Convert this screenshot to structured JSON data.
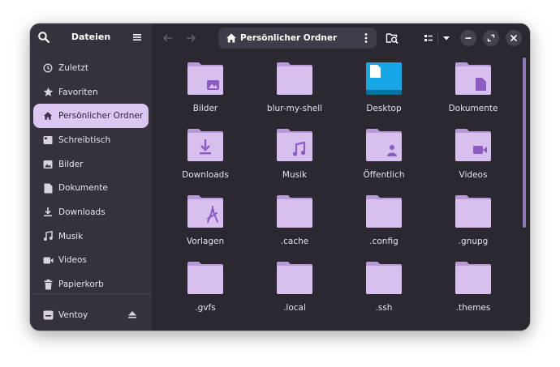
{
  "app": {
    "title": "Dateien"
  },
  "sidebar": {
    "items": [
      {
        "label": "Zuletzt",
        "icon": "clock-icon"
      },
      {
        "label": "Favoriten",
        "icon": "star-icon"
      },
      {
        "label": "Persönlicher Ordner",
        "icon": "home-icon",
        "active": true
      },
      {
        "label": "Schreibtisch",
        "icon": "desktop-icon"
      },
      {
        "label": "Bilder",
        "icon": "image-icon"
      },
      {
        "label": "Dokumente",
        "icon": "document-icon"
      },
      {
        "label": "Downloads",
        "icon": "download-icon"
      },
      {
        "label": "Musik",
        "icon": "music-icon"
      },
      {
        "label": "Videos",
        "icon": "video-icon"
      },
      {
        "label": "Papierkorb",
        "icon": "trash-icon"
      }
    ],
    "device": {
      "label": "Ventoy",
      "icon": "drive-icon"
    }
  },
  "pathbar": {
    "label": "Persönlicher Ordner"
  },
  "files": [
    {
      "name": "Bilder",
      "emblem": "image"
    },
    {
      "name": "blur-my-shell",
      "emblem": "none"
    },
    {
      "name": "Desktop",
      "emblem": "desktop"
    },
    {
      "name": "Dokumente",
      "emblem": "document"
    },
    {
      "name": "Downloads",
      "emblem": "download"
    },
    {
      "name": "Musik",
      "emblem": "music"
    },
    {
      "name": "Öffentlich",
      "emblem": "person"
    },
    {
      "name": "Videos",
      "emblem": "video"
    },
    {
      "name": "Vorlagen",
      "emblem": "template"
    },
    {
      "name": ".cache",
      "emblem": "none"
    },
    {
      "name": ".config",
      "emblem": "none"
    },
    {
      "name": ".gnupg",
      "emblem": "none"
    },
    {
      "name": ".gvfs",
      "emblem": "none"
    },
    {
      "name": ".local",
      "emblem": "none"
    },
    {
      "name": ".ssh",
      "emblem": "none"
    },
    {
      "name": ".themes",
      "emblem": "none"
    }
  ],
  "colors": {
    "folder_back": "#b99ad8",
    "folder_front": "#d7c0ee",
    "emblem": "#8a5cc4",
    "accent_active": "#dcc6f2",
    "desktop_blue": "#18a7e6"
  }
}
